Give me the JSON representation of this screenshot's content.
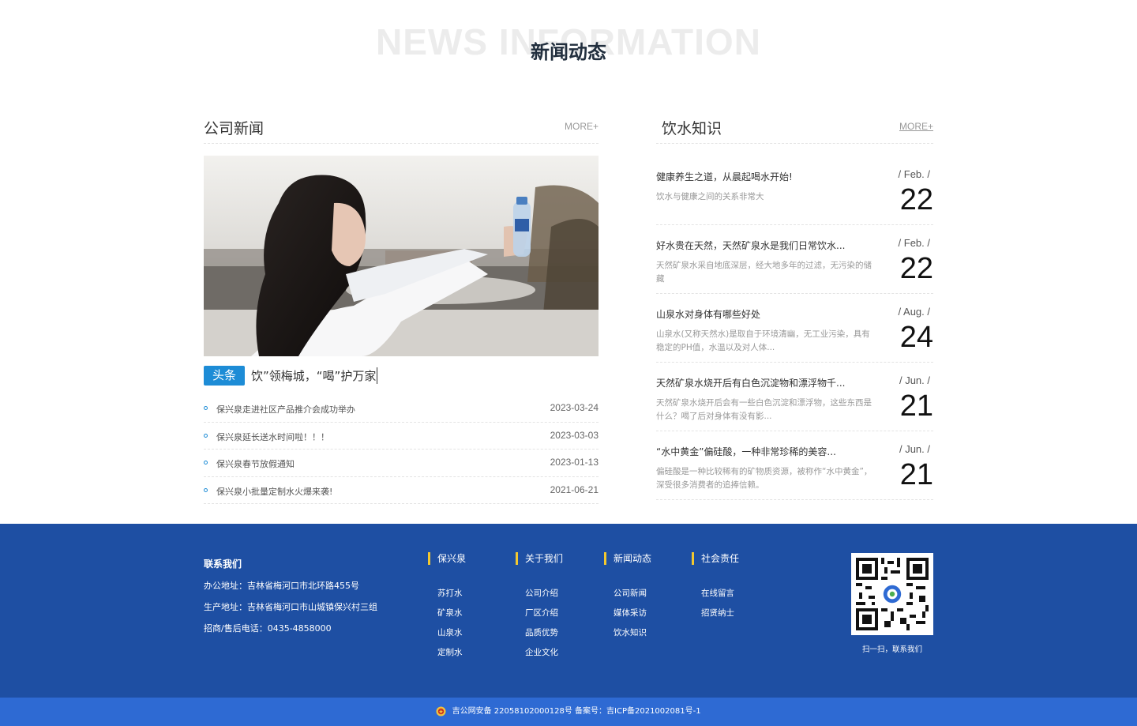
{
  "section": {
    "bg_text": "NEWS INFORMATION",
    "title": "新闻动态"
  },
  "company_news": {
    "title": "公司新闻",
    "more": "MORE+",
    "badge": "头条",
    "headline": "饮”领梅城，“喝”护万家",
    "items": [
      {
        "title": "保兴泉走进社区产品推介会成功举办",
        "date": "2023-03-24"
      },
      {
        "title": "保兴泉延长送水时间啦！！！",
        "date": "2023-03-03"
      },
      {
        "title": "保兴泉春节放假通知",
        "date": "2023-01-13"
      },
      {
        "title": "保兴泉小批量定制水火爆来袭!",
        "date": "2021-06-21"
      }
    ]
  },
  "knowledge": {
    "title": "饮水知识",
    "more": "MORE+",
    "items": [
      {
        "title": "健康养生之道，从晨起喝水开始!",
        "desc": "饮水与健康之间的关系非常大",
        "month": "/ Feb. /",
        "day": "22"
      },
      {
        "title": "好水贵在天然，天然矿泉水是我们日常饮水...",
        "desc": "天然矿泉水采自地底深层，经大地多年的过滤，无污染的储藏",
        "month": "/ Feb. /",
        "day": "22"
      },
      {
        "title": "山泉水对身体有哪些好处",
        "desc": "山泉水(又称天然水)是取自于环境清幽，无工业污染，具有稳定的PH值，水温以及对人体...",
        "month": "/ Aug. /",
        "day": "24"
      },
      {
        "title": "天然矿泉水烧开后有白色沉淀物和漂浮物千...",
        "desc": "天然矿泉水烧开后会有一些白色沉淀和漂浮物，这些东西是什么？喝了后对身体有没有影...",
        "month": "/ Jun. /",
        "day": "21"
      },
      {
        "title": "“水中黄金”偏硅酸，一种非常珍稀的美容...",
        "desc": "偏硅酸是一种比较稀有的矿物质资源，被称作“水中黄金”，深受很多消费者的追捧信赖。",
        "month": "/ Jun. /",
        "day": "21"
      }
    ]
  },
  "footer": {
    "contact": {
      "title": "联系我们",
      "office": "办公地址：吉林省梅河口市北环路455号",
      "factory": "生产地址：吉林省梅河口市山城镇保兴村三组",
      "phone": "招商/售后电话：0435-4858000"
    },
    "columns": [
      {
        "title": "保兴泉",
        "items": [
          "苏打水",
          "矿泉水",
          "山泉水",
          "定制水"
        ]
      },
      {
        "title": "关于我们",
        "items": [
          "公司介绍",
          "厂区介绍",
          "品质优势",
          "企业文化"
        ]
      },
      {
        "title": "新闻动态",
        "items": [
          "公司新闻",
          "媒体采访",
          "饮水知识"
        ]
      },
      {
        "title": "社会责任",
        "items": [
          "在线留言",
          "招贤纳士"
        ]
      }
    ],
    "qr_caption": "扫一扫，联系我们",
    "beian": "吉公网安备 22058102000128号   备案号：吉ICP备2021002081号-1"
  },
  "colors": {
    "footer_bg": "#1e4fa3",
    "bottom_bar": "#2e6ad3",
    "accent": "#1d8cd6",
    "divider_yellow": "#f2c830"
  }
}
